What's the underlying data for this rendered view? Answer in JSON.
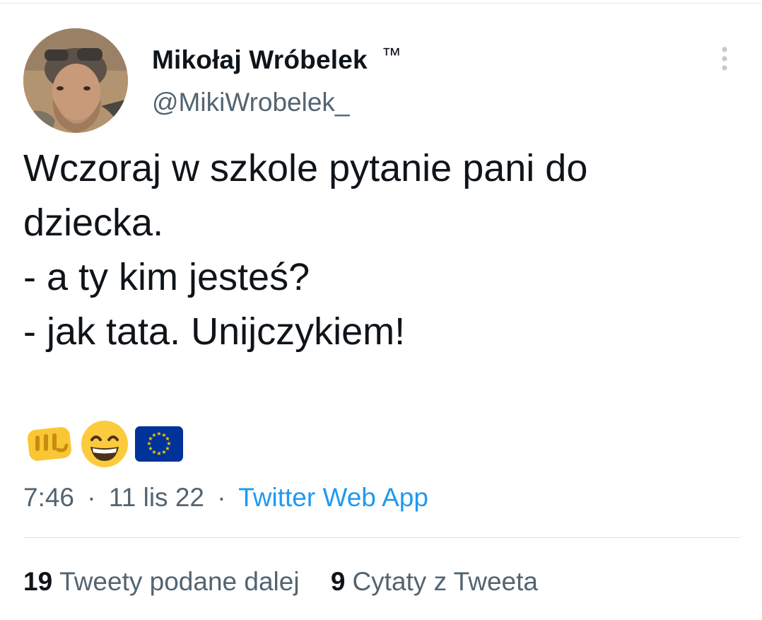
{
  "author": {
    "display_name": "Mikołaj Wróbelek",
    "badge": "™",
    "handle": "@MikiWrobelek_"
  },
  "tweet": {
    "lines": [
      "Wczoraj w szkole pytanie pani do",
      "dziecka.",
      "- a ty kim jesteś?",
      "- jak tata. Unijczykiem!"
    ],
    "emojis": [
      "fist-icon",
      "grinning-face-icon",
      "eu-flag-icon"
    ]
  },
  "meta": {
    "time": "7:46",
    "date": "11 lis 22",
    "separator": "·",
    "source": "Twitter Web App"
  },
  "stats": {
    "retweets_count": "19",
    "retweets_label": "Tweety podane dalej",
    "quotes_count": "9",
    "quotes_label": "Cytaty z Tweeta"
  },
  "colors": {
    "text": "#0f1419",
    "secondary": "#536471",
    "link": "#1d9bf0",
    "eu_blue": "#003399",
    "eu_gold": "#ffcc00"
  }
}
